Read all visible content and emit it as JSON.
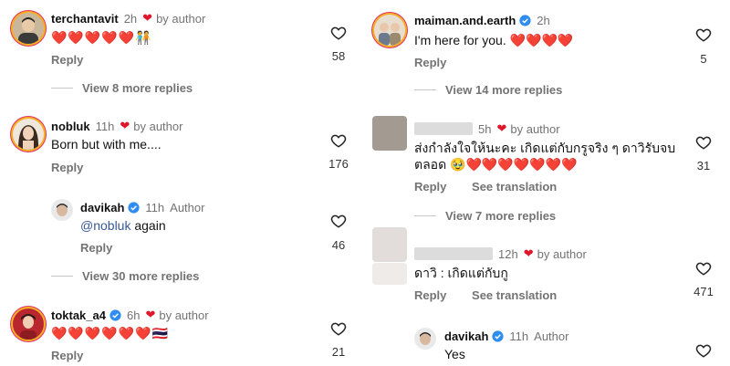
{
  "colors": {
    "heart": "#e0162b",
    "verified": "#2f8cf0",
    "muted": "#737373",
    "link": "#385898"
  },
  "left": {
    "c1": {
      "username": "terchantavit",
      "time": "2h",
      "by_author": "by author",
      "text": "❤️❤️❤️❤️❤️🧑‍🤝‍🧑",
      "reply": "Reply",
      "likes": "58",
      "more": "View 8 more replies"
    },
    "c2": {
      "username": "nobluk",
      "time": "11h",
      "by_author": "by author",
      "text": "Born but with me....",
      "reply": "Reply",
      "likes": "176"
    },
    "c2r": {
      "username": "davikah",
      "time": "11h",
      "author": "Author",
      "mention": "@nobluk",
      "text": " again",
      "reply": "Reply",
      "likes": "46",
      "more": "View 30 more replies"
    },
    "c3": {
      "username": "toktak_a4",
      "time": "6h",
      "by_author": "by author",
      "text": "❤️❤️❤️❤️❤️❤️🇹🇭",
      "reply": "Reply",
      "likes": "21"
    }
  },
  "right": {
    "c1": {
      "username": "maiman.and.earth",
      "time": "2h",
      "text": "I'm here for you. ❤️❤️❤️❤️",
      "reply": "Reply",
      "likes": "5",
      "more": "View 14 more replies"
    },
    "c2": {
      "time": "5h",
      "by_author": "by author",
      "line1": "ส่งกำลังใจให้นะคะ เกิดแต่กับกรูจริง ๆ ดาวิรับจบ",
      "line2": "ตลอด 🥹❤️❤️❤️❤️❤️❤️❤️",
      "reply": "Reply",
      "translate": "See translation",
      "likes": "31",
      "more": "View 7 more replies"
    },
    "c3": {
      "time": "12h",
      "by_author": "by author",
      "text": "ดาวิ : เกิดแต่กับกู",
      "reply": "Reply",
      "translate": "See translation",
      "likes": "471"
    },
    "c3r": {
      "username": "davikah",
      "time": "11h",
      "author": "Author",
      "text": "Yes"
    }
  }
}
